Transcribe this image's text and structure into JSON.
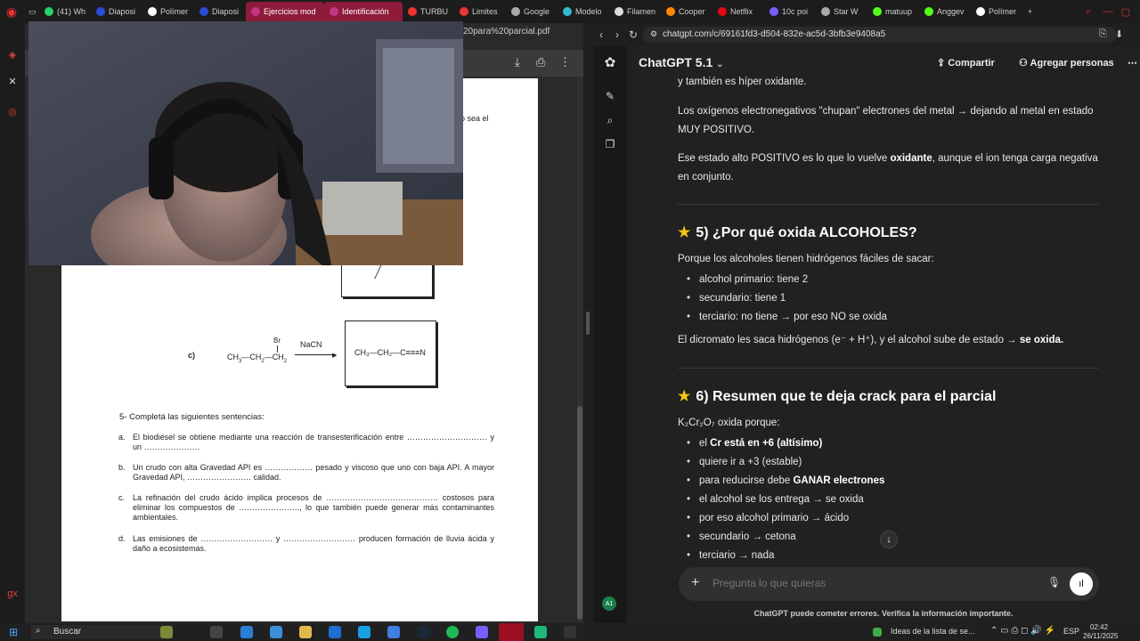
{
  "tabs": [
    {
      "label": "(41) Wh",
      "color": "#25d366"
    },
    {
      "label": "Diaposi",
      "color": "#2b4bd8"
    },
    {
      "label": "Polímer",
      "color": "#ffffff"
    },
    {
      "label": "Diaposi",
      "color": "#2b4bd8"
    },
    {
      "label": "Ejercicios mod",
      "color": "#c13584",
      "active": true
    },
    {
      "label": "Identificación",
      "color": "#c13584",
      "active": true
    },
    {
      "label": "TURBU",
      "color": "#e33"
    },
    {
      "label": "Limites",
      "color": "#e33"
    },
    {
      "label": "Google",
      "color": "#aaa"
    },
    {
      "label": "Modelo",
      "color": "#3bc"
    },
    {
      "label": "Filamen",
      "color": "#ddd"
    },
    {
      "label": "Cooper",
      "color": "#f80"
    },
    {
      "label": "Netflix",
      "color": "#e50914"
    },
    {
      "label": "10c poi",
      "color": "#7a5cff"
    },
    {
      "label": "Star W",
      "color": "#aaa"
    },
    {
      "label": "matuup",
      "color": "#53fc18"
    },
    {
      "label": "Anggev",
      "color": "#53fc18"
    },
    {
      "label": "Polímer",
      "color": "#ffffff"
    }
  ],
  "new_tab": "+",
  "pdf": {
    "address": "20para%20parcial.pdf",
    "partial_text": "o sea el",
    "reaction": {
      "label": "c)",
      "reagent_top": "Br",
      "reactant_a": "CH",
      "reactant_sub3": "3",
      "reactant_b": "—CH",
      "reactant_sub2a": "2",
      "reactant_c": "—CH",
      "reactant_sub2b": "2",
      "arrow_reagent": "NaCN",
      "product": "CH₃—CH₂—C≡≡≡N"
    },
    "question_title": "5-   Completá las siguientes sentencias:",
    "items": [
      {
        "letter": "a.",
        "text": "El biodiésel se obtiene mediante una reacción de transesterificación entre ………………………… y un …………………"
      },
      {
        "letter": "b.",
        "text": "Un crudo con alta Gravedad API es ……………… pesado y viscoso que uno con baja API. A mayor Gravedad API, …………………… calidad."
      },
      {
        "letter": "c.",
        "text": "La refinación del crudo ácido implica procesos de …………………………………… costosos para eliminar los compuestos de ………………….., lo que también puede generar más contaminantes ambientales."
      },
      {
        "letter": "d.",
        "text": "Las emisiones de ……………………… y ……………………… producen formación de lluvia ácida y daño a ecosistemas."
      }
    ]
  },
  "right_browser": {
    "url": "chatgpt.com/c/69161fd3-d504-832e-ac5d-3bfb3e9408a5"
  },
  "chat": {
    "model": "ChatGPT 5.1",
    "share_label": "Compartir",
    "add_people_label": "Agregar personas",
    "line_top": "y también es híper oxidante.",
    "para1": "Los oxígenos electronegativos \"chupan\" electrones del metal → dejando al metal en estado MUY POSITIVO.",
    "para2_a": "Ese estado alto POSITIVO es lo que lo vuelve ",
    "para2_b": "oxidante",
    "para2_c": ", aunque el ion tenga carga negativa en conjunto.",
    "h5": "5) ¿Por qué oxida ALCOHOLES?",
    "h5_intro": "Porque los alcoholes tienen hidrógenos fáciles de sacar:",
    "h5_list": [
      "alcohol primario: tiene 2",
      "secundario: tiene 1",
      "terciario: no tiene → por eso NO se oxida"
    ],
    "h5_outro_a": "El dicromato les saca hidrógenos (e⁻ + H⁺), y el alcohol sube de estado → ",
    "h5_outro_b": "se oxida.",
    "h6": "6) Resumen que te deja crack para el parcial",
    "h6_intro": "K₂Cr₂O₇ oxida porque:",
    "h6_list": [
      {
        "pre": "el ",
        "bold": "Cr está en +6 (altísimo)",
        "post": ""
      },
      {
        "pre": "quiere ir a +3 (estable)",
        "bold": "",
        "post": ""
      },
      {
        "pre": "para reducirse debe ",
        "bold": "GANAR electrones",
        "post": ""
      },
      {
        "pre": "el alcohol se los entrega → se oxida",
        "bold": "",
        "post": ""
      },
      {
        "pre": "por eso alcohol primario → ácido",
        "bold": "",
        "post": ""
      },
      {
        "pre": "secundario → cetona",
        "bold": "",
        "post": ""
      },
      {
        "pre": "terciario → nada",
        "bold": "",
        "post": ""
      }
    ],
    "composer_placeholder": "Pregunta lo que quieras",
    "disclaimer": "ChatGPT puede cometer errores. Verifica la información importante.",
    "avatar": "A1"
  },
  "taskbar": {
    "search_label": "Buscar",
    "news": "Ideas de la lista de se...",
    "lang": "ESP",
    "time": "02:42",
    "date": "26/11/2025"
  }
}
